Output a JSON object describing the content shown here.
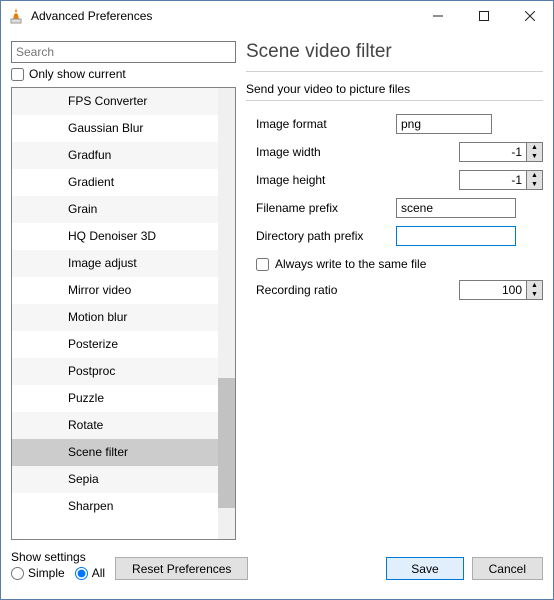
{
  "window": {
    "title": "Advanced Preferences",
    "min_tooltip": "Minimize",
    "max_tooltip": "Maximize",
    "close_tooltip": "Close"
  },
  "left": {
    "search_placeholder": "Search",
    "only_show_label": "Only show current",
    "items": [
      "FPS Converter",
      "Gaussian Blur",
      "Gradfun",
      "Gradient",
      "Grain",
      "HQ Denoiser 3D",
      "Image adjust",
      "Mirror video",
      "Motion blur",
      "Posterize",
      "Postproc",
      "Puzzle",
      "Rotate",
      "Scene filter",
      "Sepia",
      "Sharpen"
    ],
    "selected_index": 13
  },
  "panel": {
    "title": "Scene video filter",
    "subtitle": "Send your video to picture files",
    "rows": {
      "image_format_label": "Image format",
      "image_format_value": "png",
      "image_width_label": "Image width",
      "image_width_value": "-1",
      "image_height_label": "Image height",
      "image_height_value": "-1",
      "filename_prefix_label": "Filename prefix",
      "filename_prefix_value": "scene",
      "dir_prefix_label": "Directory path prefix",
      "dir_prefix_value": "",
      "always_write_label": "Always write to the same file",
      "recording_ratio_label": "Recording ratio",
      "recording_ratio_value": "100"
    }
  },
  "footer": {
    "show_settings_label": "Show settings",
    "simple_label": "Simple",
    "all_label": "All",
    "reset_label": "Reset Preferences",
    "save_label": "Save",
    "cancel_label": "Cancel"
  }
}
